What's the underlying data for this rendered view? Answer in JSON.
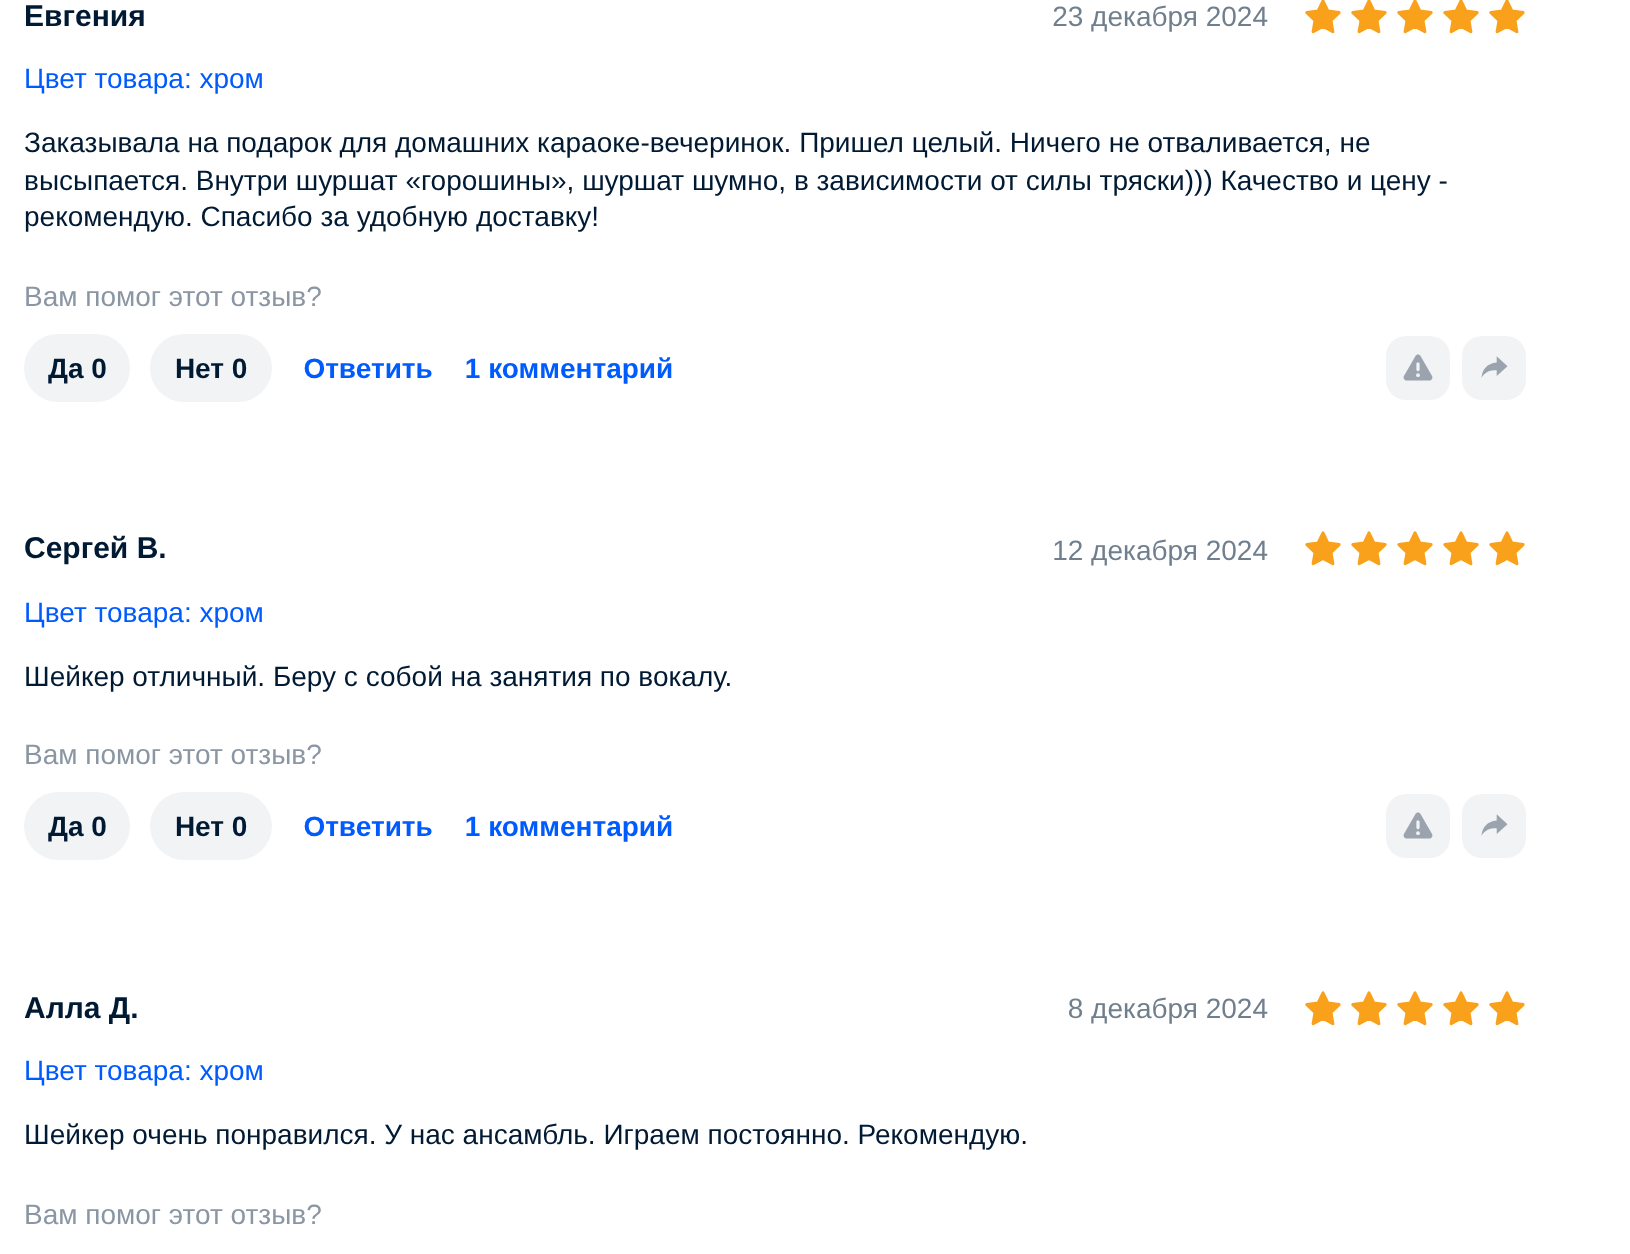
{
  "reviews": [
    {
      "author": "Евгения",
      "date": "23 декабря 2024",
      "stars": 5,
      "variant": "Цвет товара: хром",
      "text": "Заказывала на подарок для домашних караоке-вечеринок. Пришел целый. Ничего не отваливается, не высыпается. Внутри шуршат «горошины», шуршат шумно, в зависимости от силы тряски))) Качество и цену - рекомендую. Спасибо за удобную доставку!",
      "helpful_prompt": "Вам помог этот отзыв?",
      "actions": {
        "yes": "Да 0",
        "no": "Нет 0",
        "reply": "Ответить",
        "comments": "1 комментарий"
      }
    },
    {
      "author": "Сергей В.",
      "date": "12 декабря 2024",
      "stars": 5,
      "variant": "Цвет товара: хром",
      "text": "Шейкер отличный. Беру с собой на занятия по вокалу.",
      "helpful_prompt": "Вам помог этот отзыв?",
      "actions": {
        "yes": "Да 0",
        "no": "Нет 0",
        "reply": "Ответить",
        "comments": "1 комментарий"
      }
    },
    {
      "author": "Алла Д.",
      "date": "8 декабря 2024",
      "stars": 5,
      "variant": "Цвет товара: хром",
      "text": "Шейкер очень понравился. У нас ансамбль. Играем постоянно. Рекомендую.",
      "helpful_prompt": "Вам помог этот отзыв?"
    }
  ]
}
